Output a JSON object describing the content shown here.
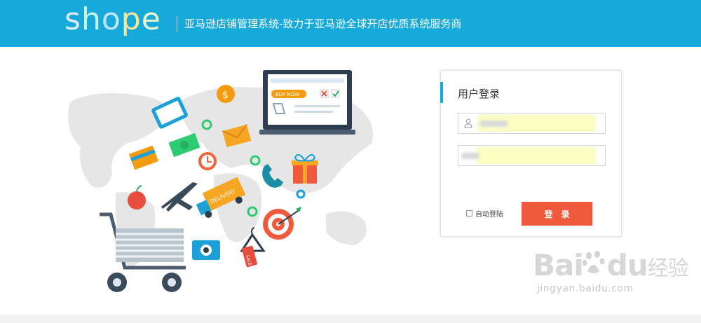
{
  "header": {
    "logo_letters": [
      "s",
      "h",
      "o",
      "p",
      "e"
    ],
    "logo_colors": [
      "#d4e7f7",
      "#c9f2e8",
      "#b8e0ff",
      "#f7e99a",
      "#e6f5d2"
    ],
    "tagline": "亚马逊店铺管理系统-致力于亚马逊全球开店优质系统服务商",
    "background_color": "#16a9d9"
  },
  "illustration": {
    "laptop_banner": "BUY NOW",
    "delivery_label": "DELIVERY",
    "sale_tag": "SALE"
  },
  "login": {
    "title": "用户登录",
    "username_value": "",
    "password_value": "",
    "remember_label": "自动登陆",
    "remember_checked": false,
    "submit_label": "登录",
    "accent_color": "#f05a3c"
  },
  "watermark": {
    "brand": "Bai",
    "brand_tail": "du",
    "brand_cn": "经验",
    "url": "jingyan.baidu.com"
  }
}
